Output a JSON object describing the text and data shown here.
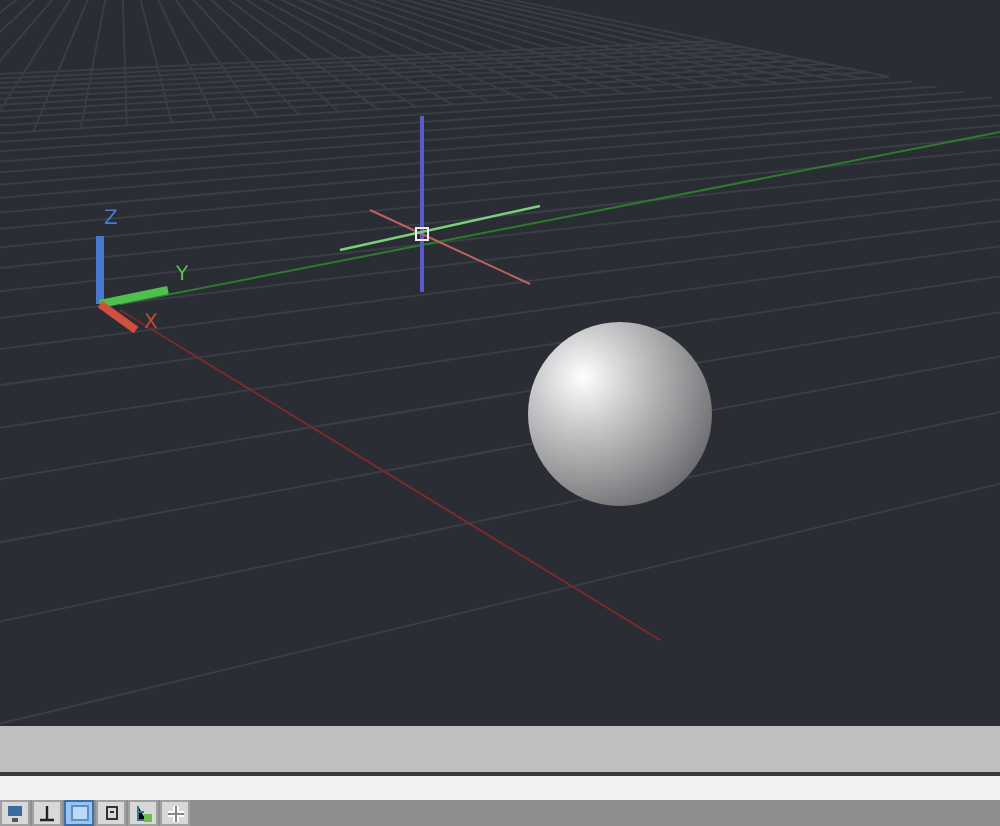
{
  "viewport": {
    "ucs_labels": [
      {
        "kind": "z",
        "text": "Z"
      },
      {
        "kind": "y",
        "text": "Y"
      },
      {
        "kind": "x",
        "text": "X"
      }
    ]
  },
  "toolbar": {
    "buttons": [
      {
        "kind": "display",
        "selected": false
      },
      {
        "kind": "ortho",
        "selected": false
      },
      {
        "kind": "grid",
        "selected": true
      },
      {
        "kind": "box",
        "selected": false
      },
      {
        "kind": "tree",
        "selected": false
      },
      {
        "kind": "plus",
        "selected": false
      }
    ]
  }
}
